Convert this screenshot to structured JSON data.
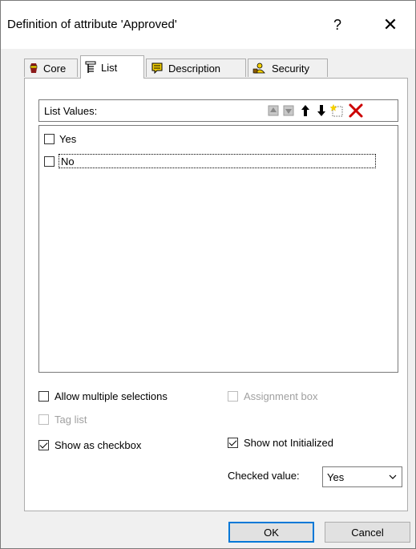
{
  "window": {
    "title": "Definition of attribute 'Approved'",
    "help_label": "?",
    "close_label": "✕"
  },
  "tabs": [
    {
      "label": "Core",
      "icon": "core-icon",
      "active": false
    },
    {
      "label": "List",
      "icon": "list-icon",
      "active": true
    },
    {
      "label": "Description",
      "icon": "description-icon",
      "active": false
    },
    {
      "label": "Security",
      "icon": "security-icon",
      "active": false
    }
  ],
  "list": {
    "header_label": "List Values:",
    "toolbar": [
      "move-up-disabled-icon",
      "move-down-disabled-icon",
      "arrow-up-icon",
      "arrow-down-icon",
      "new-item-icon",
      "delete-icon"
    ],
    "items": [
      {
        "label": "Yes",
        "checked": false
      },
      {
        "label": "No",
        "checked": false,
        "focused": true
      }
    ]
  },
  "options": {
    "allow_multiple": {
      "label": "Allow multiple selections",
      "checked": false,
      "enabled": true
    },
    "assignment_box": {
      "label": "Assignment box",
      "checked": false,
      "enabled": false
    },
    "tag_list": {
      "label": "Tag list",
      "checked": false,
      "enabled": false
    },
    "show_as_checkbox": {
      "label": "Show as checkbox",
      "checked": true,
      "enabled": true
    },
    "show_not_initialized": {
      "label": "Show not Initialized",
      "checked": true,
      "enabled": true
    },
    "checked_value": {
      "label": "Checked value:",
      "value": "Yes"
    }
  },
  "buttons": {
    "ok": "OK",
    "cancel": "Cancel"
  },
  "colors": {
    "accent": "#0078d7",
    "delete_red": "#cc0000",
    "icon_yellow": "#f5d000"
  }
}
